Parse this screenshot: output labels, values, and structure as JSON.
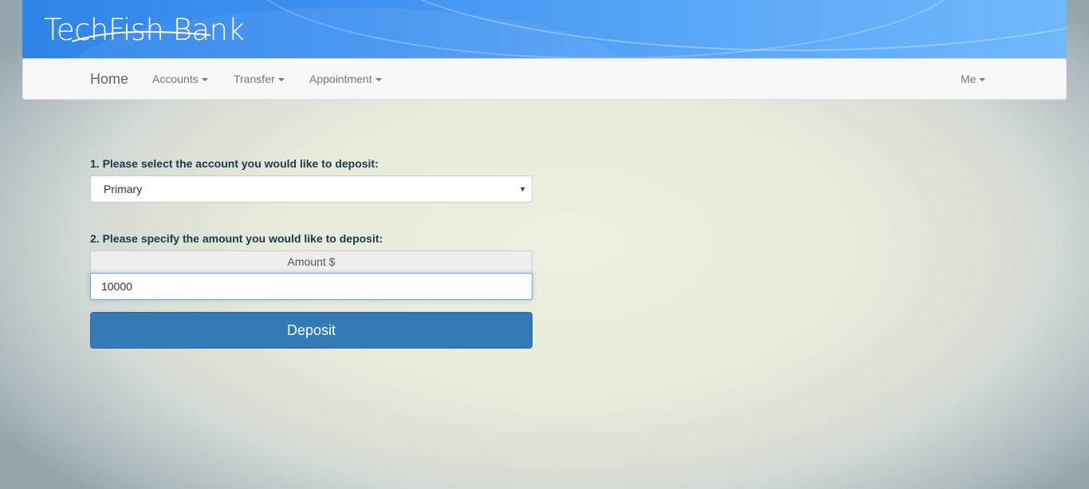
{
  "header": {
    "brand": "TechFish Bank"
  },
  "nav": {
    "home": "Home",
    "accounts": "Accounts",
    "transfer": "Transfer",
    "appointment": "Appointment",
    "me": "Me"
  },
  "form": {
    "step1_label": "1. Please select the account you would like to deposit:",
    "account_selected": "Primary",
    "step2_label": "2. Please specify the amount you would like to deposit:",
    "amount_addon": "Amount $",
    "amount_value": "10000",
    "submit_label": "Deposit"
  },
  "colors": {
    "banner": "#3d90ef",
    "navbar": "#f8f8f8",
    "button": "#337ab7",
    "label_text": "#1a3a4a"
  },
  "icons": {
    "dropdown_caret": "caret-down-icon",
    "select_arrow": "select-arrow-icon"
  }
}
